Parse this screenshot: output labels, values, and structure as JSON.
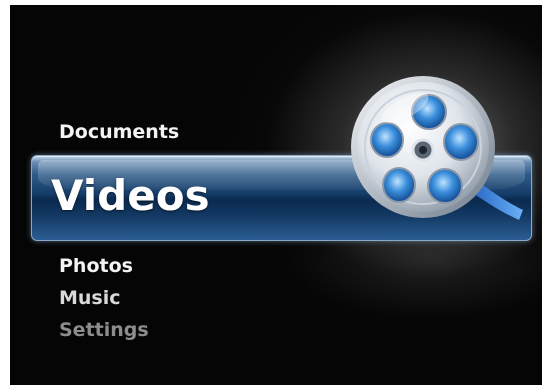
{
  "menu": {
    "items": [
      {
        "label": "Documents"
      },
      {
        "label": "Videos"
      },
      {
        "label": "Photos"
      },
      {
        "label": "Music"
      },
      {
        "label": "Settings"
      }
    ],
    "selected_label": "Videos"
  },
  "icons": {
    "selected_item_icon": "film-reel-icon"
  },
  "colors": {
    "background": "#050505",
    "selection_bar": "#153d69",
    "text_primary": "#f3f3f3",
    "text_dim": "#8d8d8d"
  }
}
